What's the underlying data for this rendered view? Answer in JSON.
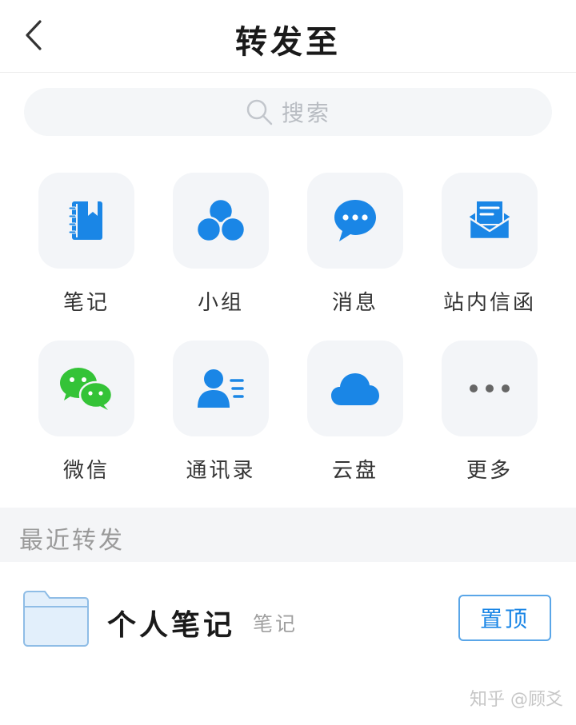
{
  "header": {
    "title": "转发至"
  },
  "search": {
    "placeholder": "搜索"
  },
  "grid": {
    "items": [
      {
        "label": "笔记",
        "icon": "notebook-icon"
      },
      {
        "label": "小组",
        "icon": "group-icon"
      },
      {
        "label": "消息",
        "icon": "message-bubble-icon"
      },
      {
        "label": "站内信函",
        "icon": "mail-icon"
      },
      {
        "label": "微信",
        "icon": "wechat-icon"
      },
      {
        "label": "通讯录",
        "icon": "contacts-icon"
      },
      {
        "label": "云盘",
        "icon": "cloud-icon"
      },
      {
        "label": "更多",
        "icon": "more-dots-icon"
      }
    ]
  },
  "recent": {
    "title": "最近转发",
    "items": [
      {
        "name": "个人笔记",
        "type": "笔记",
        "action": "置顶"
      }
    ]
  },
  "watermark": "知乎 @顾爻",
  "colors": {
    "accent": "#1a86e6",
    "wechat": "#34c337",
    "tile_bg": "#f3f5f8"
  }
}
